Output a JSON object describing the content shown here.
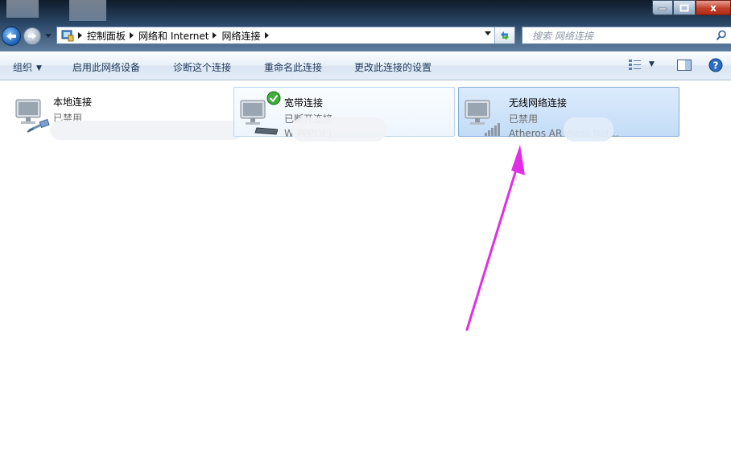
{
  "window": {
    "controls": {
      "minimize": "–",
      "maximize": "□",
      "close": "x"
    }
  },
  "address_bar": {
    "breadcrumbs": [
      "控制面板",
      "网络和 Internet",
      "网络连接"
    ]
  },
  "search": {
    "placeholder": "搜索 网络连接"
  },
  "toolbar": {
    "organize": "组织",
    "enable_device": "启用此网络设备",
    "diagnose": "诊断这个连接",
    "rename": "重命名此连接",
    "change_settings": "更改此连接的设置"
  },
  "connections": [
    {
      "name": "本地连接",
      "status": "已禁用",
      "device": "",
      "icon": "ethernet-cable-icon"
    },
    {
      "name": "宽带连接",
      "status": "已断开连接",
      "device": "W                         PPPOE)",
      "icon": "modem-icon",
      "badge": "green-check-icon"
    },
    {
      "name": "无线网络连接",
      "status": "已禁用",
      "device": "Atheros AR          eless Net...",
      "icon": "wireless-signal-icon"
    }
  ],
  "colors": {
    "annotation_arrow": "#e02ee8",
    "selection": "#c3dcf7",
    "toolbar_text": "#1e395b"
  }
}
